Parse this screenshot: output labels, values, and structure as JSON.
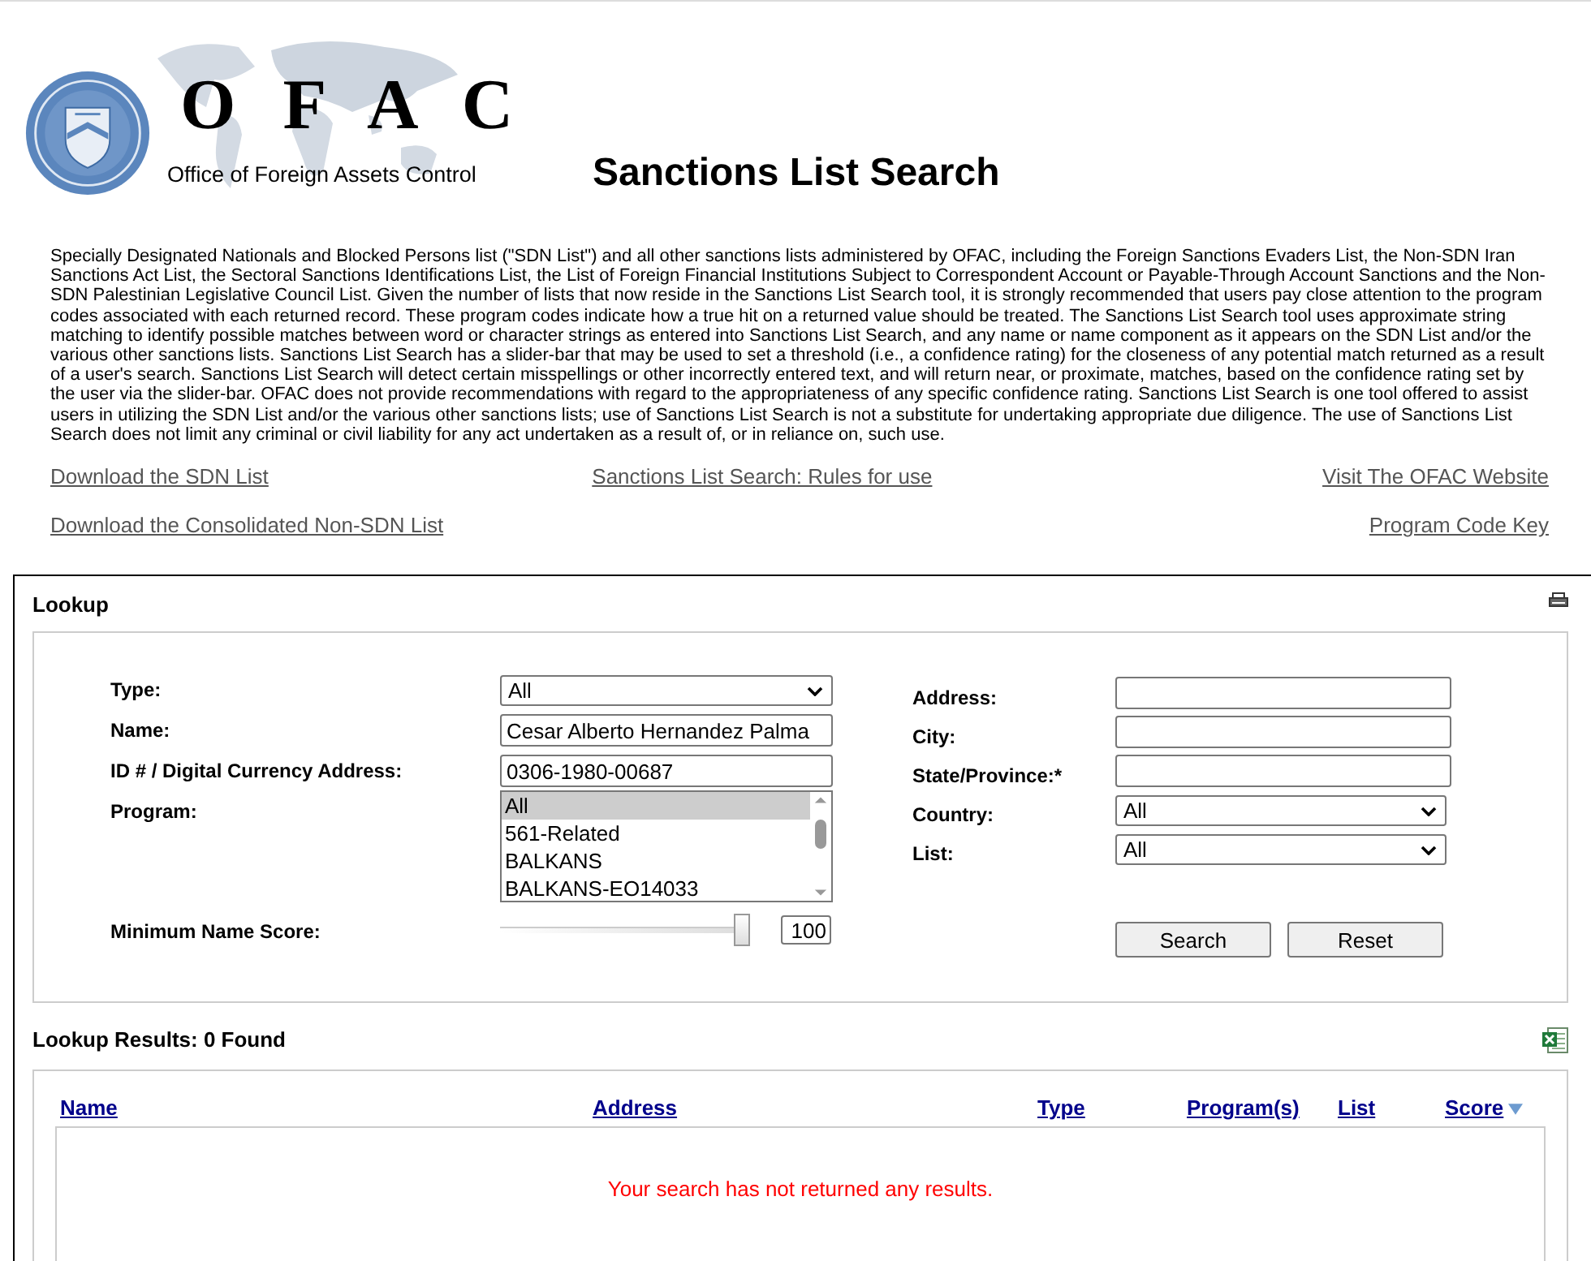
{
  "logo": {
    "letters": "O F A C",
    "subtitle": "Office of Foreign Assets Control"
  },
  "page_title": "Sanctions List Search",
  "intro": "Specially Designated Nationals and Blocked Persons list (\"SDN List\") and all other sanctions lists administered by OFAC, including the Foreign Sanctions Evaders List, the Non-SDN Iran Sanctions Act List, the Sectoral Sanctions Identifications List, the List of Foreign Financial Institutions Subject to Correspondent Account or Payable-Through Account Sanctions and the Non-SDN Palestinian Legislative Council List. Given the number of lists that now reside in the Sanctions List Search tool, it is strongly recommended that users pay close attention to the program codes associated with each returned record. These program codes indicate how a true hit on a returned value should be treated. The Sanctions List Search tool uses approximate string matching to identify possible matches between word or character strings as entered into Sanctions List Search, and any name or name component as it appears on the SDN List and/or the various other sanctions lists. Sanctions List Search has a slider-bar that may be used to set a threshold (i.e., a confidence rating) for the closeness of any potential match returned as a result of a user's search. Sanctions List Search will detect certain misspellings or other incorrectly entered text, and will return near, or proximate, matches, based on the confidence rating set by the user via the slider-bar. OFAC does not provide recommendations with regard to the appropriateness of any specific confidence rating. Sanctions List Search is one tool offered to assist users in utilizing the SDN List and/or the various other sanctions lists; use of Sanctions List Search is not a substitute for undertaking appropriate due diligence. The use of Sanctions List Search does not limit any criminal or civil liability for any act undertaken as a result of, or in reliance on, such use.",
  "links": {
    "left": [
      "Download the SDN List",
      "Download the Consolidated Non-SDN List"
    ],
    "center": [
      "Sanctions List Search: Rules for use"
    ],
    "right": [
      "Visit The OFAC Website",
      "Program Code Key"
    ]
  },
  "lookup": {
    "title": "Lookup",
    "type": {
      "label": "Type:",
      "value": "All"
    },
    "name": {
      "label": "Name:",
      "value": "Cesar Alberto Hernandez Palma"
    },
    "id": {
      "label": "ID # / Digital Currency Address:",
      "value": "0306-1980-00687"
    },
    "program": {
      "label": "Program:",
      "items": [
        {
          "label": "All",
          "selected": true
        },
        {
          "label": "561-Related",
          "selected": false
        },
        {
          "label": "BALKANS",
          "selected": false
        },
        {
          "label": "BALKANS-EO14033",
          "selected": false
        }
      ]
    },
    "score": {
      "label": "Minimum Name Score:",
      "level": 1,
      "value": "100"
    },
    "address": {
      "label": "Address:"
    },
    "city": {
      "label": "City:"
    },
    "state": {
      "label": "State/Province:*"
    },
    "country": {
      "label": "Country:",
      "value": "All"
    },
    "list": {
      "label": "List:",
      "value": "All"
    },
    "buttons": [
      "Search",
      "Reset"
    ]
  },
  "results": {
    "title": "Lookup Results: 0 Found",
    "columns": [
      {
        "label": "Name",
        "sorted": false
      },
      {
        "label": "Address",
        "sorted": false
      },
      {
        "label": "Type",
        "sorted": false
      },
      {
        "label": "Program(s)",
        "sorted": false
      },
      {
        "label": "List",
        "sorted": false
      },
      {
        "label": "Score",
        "sorted": true
      }
    ],
    "message": "Your search has not returned any results."
  }
}
